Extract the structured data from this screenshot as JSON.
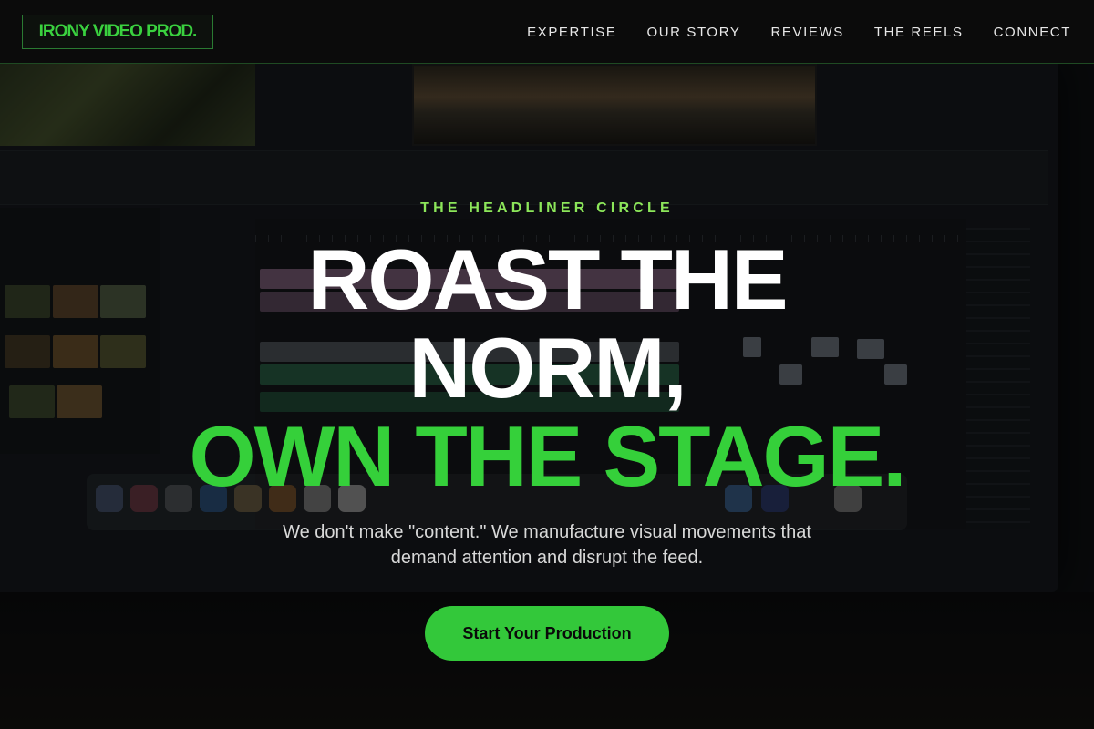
{
  "header": {
    "logo_text": "IRONY VIDEO PROD.",
    "nav": [
      {
        "label": "EXPERTISE"
      },
      {
        "label": "OUR STORY"
      },
      {
        "label": "REVIEWS"
      },
      {
        "label": "THE REELS"
      },
      {
        "label": "CONNECT"
      }
    ]
  },
  "hero": {
    "eyebrow": "THE HEADLINER CIRCLE",
    "headline_line1": "ROAST THE",
    "headline_line2": "NORM,",
    "headline_line3": "OWN THE STAGE.",
    "subtext_line1": "We don't make \"content.\" We manufacture visual movements that",
    "subtext_line2": "demand attention and disrupt the feed.",
    "cta_label": "Start Your Production"
  },
  "colors": {
    "accent": "#35d03a",
    "eyebrow": "#8ce65a",
    "header_bg": "#0b0b0b",
    "cta_bg": "#33c83a"
  }
}
